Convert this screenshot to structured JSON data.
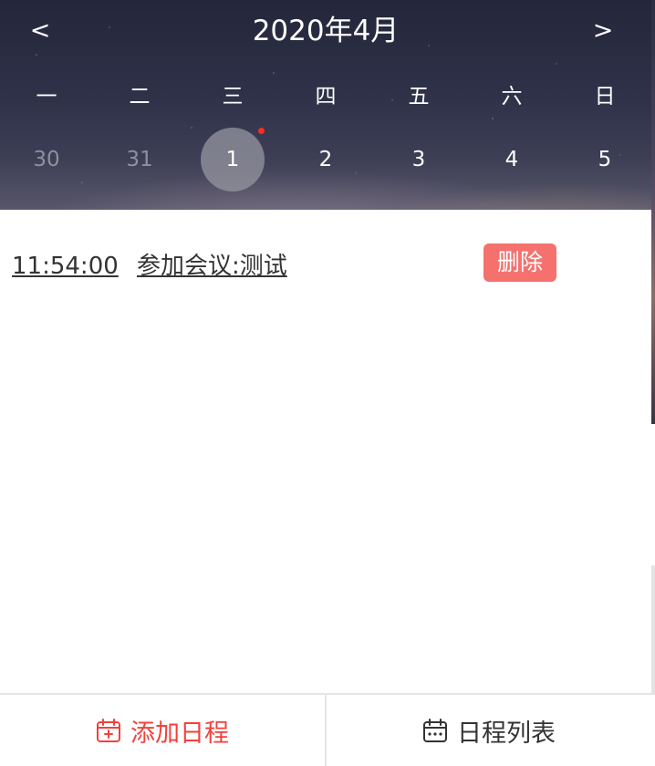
{
  "calendar": {
    "prev_label": "<",
    "next_label": ">",
    "month_title": "2020年4月",
    "weekdays": [
      "一",
      "二",
      "三",
      "四",
      "五",
      "六",
      "日"
    ],
    "dates": [
      {
        "label": "30",
        "in_month": false,
        "selected": false,
        "has_event": false
      },
      {
        "label": "31",
        "in_month": false,
        "selected": false,
        "has_event": false
      },
      {
        "label": "1",
        "in_month": true,
        "selected": true,
        "has_event": true
      },
      {
        "label": "2",
        "in_month": true,
        "selected": false,
        "has_event": false
      },
      {
        "label": "3",
        "in_month": true,
        "selected": false,
        "has_event": false
      },
      {
        "label": "4",
        "in_month": true,
        "selected": false,
        "has_event": false
      },
      {
        "label": "5",
        "in_month": true,
        "selected": false,
        "has_event": false
      }
    ]
  },
  "schedule": {
    "items": [
      {
        "time": "11:54:00",
        "title": "参加会议:测试",
        "delete_label": "删除"
      }
    ]
  },
  "bottom_bar": {
    "add_label": "添加日程",
    "list_label": "日程列表"
  },
  "colors": {
    "accent_red": "#f2413c",
    "delete_bg": "#f4716e",
    "event_dot": "#ff2d1e",
    "text_dark": "#333333"
  },
  "icons": {
    "add": "calendar-add-icon",
    "list": "calendar-list-icon"
  }
}
